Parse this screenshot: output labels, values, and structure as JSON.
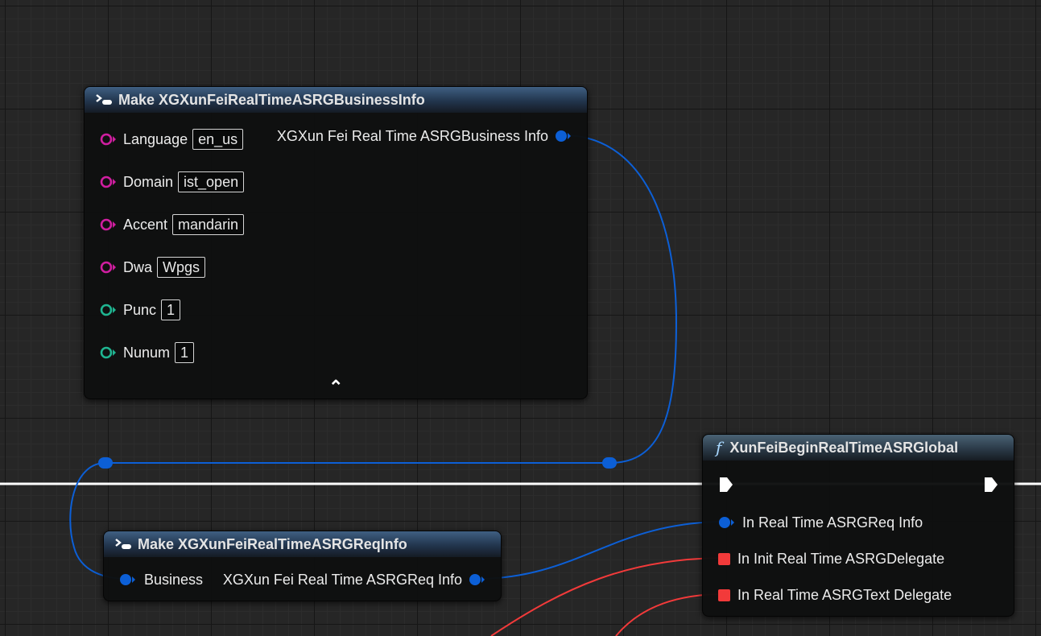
{
  "business_info_node": {
    "title": "Make XGXunFeiRealTimeASRGBusinessInfo",
    "inputs": [
      {
        "label": "Language",
        "value": "en_us",
        "pin_color": "#d01ea0"
      },
      {
        "label": "Domain",
        "value": "ist_open",
        "pin_color": "#d01ea0"
      },
      {
        "label": "Accent",
        "value": "mandarin",
        "pin_color": "#d01ea0"
      },
      {
        "label": "Dwa",
        "value": "Wpgs",
        "pin_color": "#d01ea0"
      },
      {
        "label": "Punc",
        "value": "1",
        "pin_color": "#1fb591"
      },
      {
        "label": "Nunum",
        "value": "1",
        "pin_color": "#1fb591"
      }
    ],
    "output_label": "XGXun Fei Real Time ASRGBusiness Info",
    "collapse_glyph": "⌃"
  },
  "req_info_node": {
    "title": "Make XGXunFeiRealTimeASRGReqInfo",
    "input_label": "Business",
    "output_label": "XGXun Fei Real Time ASRGReq Info"
  },
  "begin_node": {
    "title": "XunFeiBeginRealTimeASRGlobal",
    "function_glyph": "f",
    "inputs": [
      {
        "label": "In Real Time ASRGReq Info",
        "pin": "struct"
      },
      {
        "label": "In Init Real Time ASRGDelegate",
        "pin": "delegate"
      },
      {
        "label": "In Real Time ASRGText Delegate",
        "pin": "delegate"
      }
    ]
  },
  "colors": {
    "struct_pin": "#0c5fd6",
    "string_pin": "#d01ea0",
    "int_pin": "#1fb591",
    "delegate_pin": "#f23a3a",
    "exec_wire": "#ffffff",
    "graph_background": "#262626"
  }
}
